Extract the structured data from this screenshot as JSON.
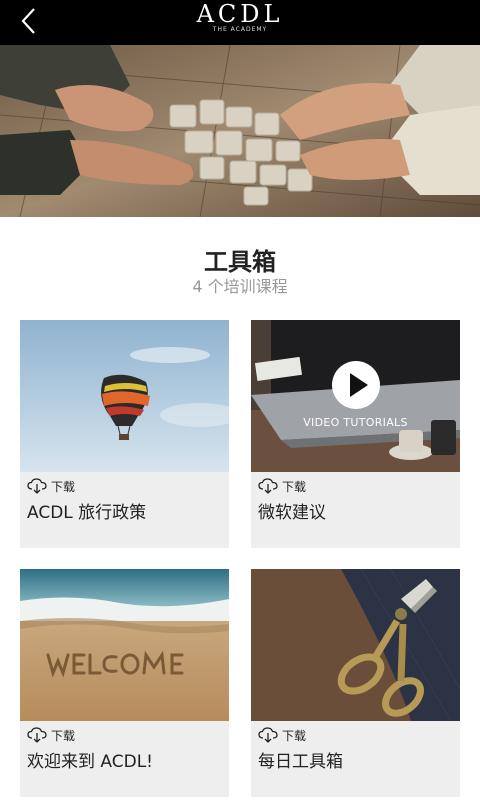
{
  "header": {
    "logo_text": "ACDL",
    "logo_subtext": "THE ACADEMY"
  },
  "toolbox": {
    "title": "工具箱",
    "subtitle": "4 个培训课程"
  },
  "courses": [
    {
      "title": "ACDL 旅行政策",
      "download_label": "下载",
      "thumbnail": "hot-air-balloon"
    },
    {
      "title": "微软建议",
      "download_label": "下载",
      "thumbnail": "video-tutorials-laptop",
      "overlay_text": "VIDEO TUTORIALS"
    },
    {
      "title": "欢迎来到 ACDL!",
      "download_label": "下载",
      "thumbnail": "welcome-in-sand"
    },
    {
      "title": "每日工具箱",
      "download_label": "下载",
      "thumbnail": "scissors-fabric"
    }
  ],
  "icons": {
    "back": "chevron-left-icon",
    "download": "cloud-download-icon",
    "play": "play-icon"
  }
}
